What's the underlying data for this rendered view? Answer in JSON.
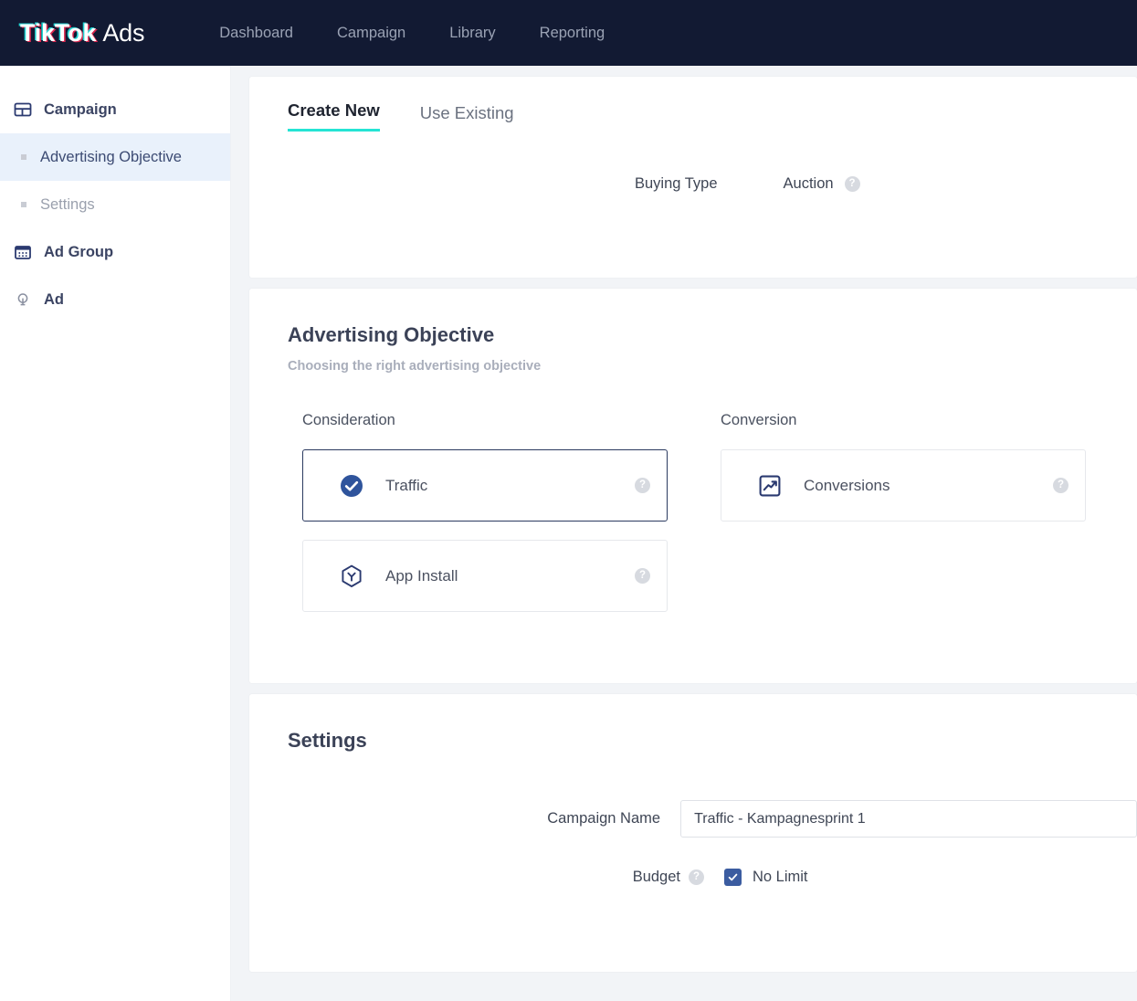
{
  "header": {
    "brand_bold": "TikTok",
    "brand_light": "Ads",
    "nav": [
      {
        "label": "Dashboard",
        "name": "nav-dashboard"
      },
      {
        "label": "Campaign",
        "name": "nav-campaign"
      },
      {
        "label": "Library",
        "name": "nav-library"
      },
      {
        "label": "Reporting",
        "name": "nav-reporting"
      }
    ]
  },
  "sidebar": {
    "items": [
      {
        "label": "Campaign",
        "icon": "panel-icon",
        "type": "group"
      },
      {
        "label": "Advertising Objective",
        "icon": "bullet-icon",
        "type": "sub",
        "state": "active"
      },
      {
        "label": "Settings",
        "icon": "bullet-icon",
        "type": "sub",
        "state": "muted"
      },
      {
        "label": "Ad Group",
        "icon": "calendar-icon",
        "type": "group"
      },
      {
        "label": "Ad",
        "icon": "lightbulb-icon",
        "type": "group"
      }
    ]
  },
  "buying": {
    "tabs": [
      {
        "label": "Create New",
        "active": true
      },
      {
        "label": "Use Existing",
        "active": false
      }
    ],
    "type_label": "Buying Type",
    "type_value": "Auction",
    "help": "?"
  },
  "objective": {
    "title": "Advertising Objective",
    "subtitle": "Choosing the right advertising objective",
    "columns": [
      {
        "heading": "Consideration",
        "cards": [
          {
            "label": "Traffic",
            "icon": "check-circle-icon",
            "selected": true,
            "help": "?"
          },
          {
            "label": "App Install",
            "icon": "hexagon-app-icon",
            "selected": false,
            "help": "?"
          }
        ]
      },
      {
        "heading": "Conversion",
        "cards": [
          {
            "label": "Conversions",
            "icon": "trend-up-icon",
            "selected": false,
            "help": "?"
          }
        ]
      }
    ]
  },
  "settings": {
    "title": "Settings",
    "campaign_name_label": "Campaign Name",
    "campaign_name_value": "Traffic - Kampagnesprint 1",
    "campaign_name_placeholder": "Campaign Name",
    "budget_label": "Budget",
    "budget_help": "?",
    "no_limit_label": "No Limit",
    "no_limit_checked": true
  },
  "colors": {
    "nav_bg": "#121a33",
    "accent_teal": "#25e4d4",
    "accent_navy": "#2b3a60",
    "accent_blue": "#3b5ca0",
    "page_bg": "#f2f4f7",
    "active_item_bg": "#e9f1fb"
  }
}
